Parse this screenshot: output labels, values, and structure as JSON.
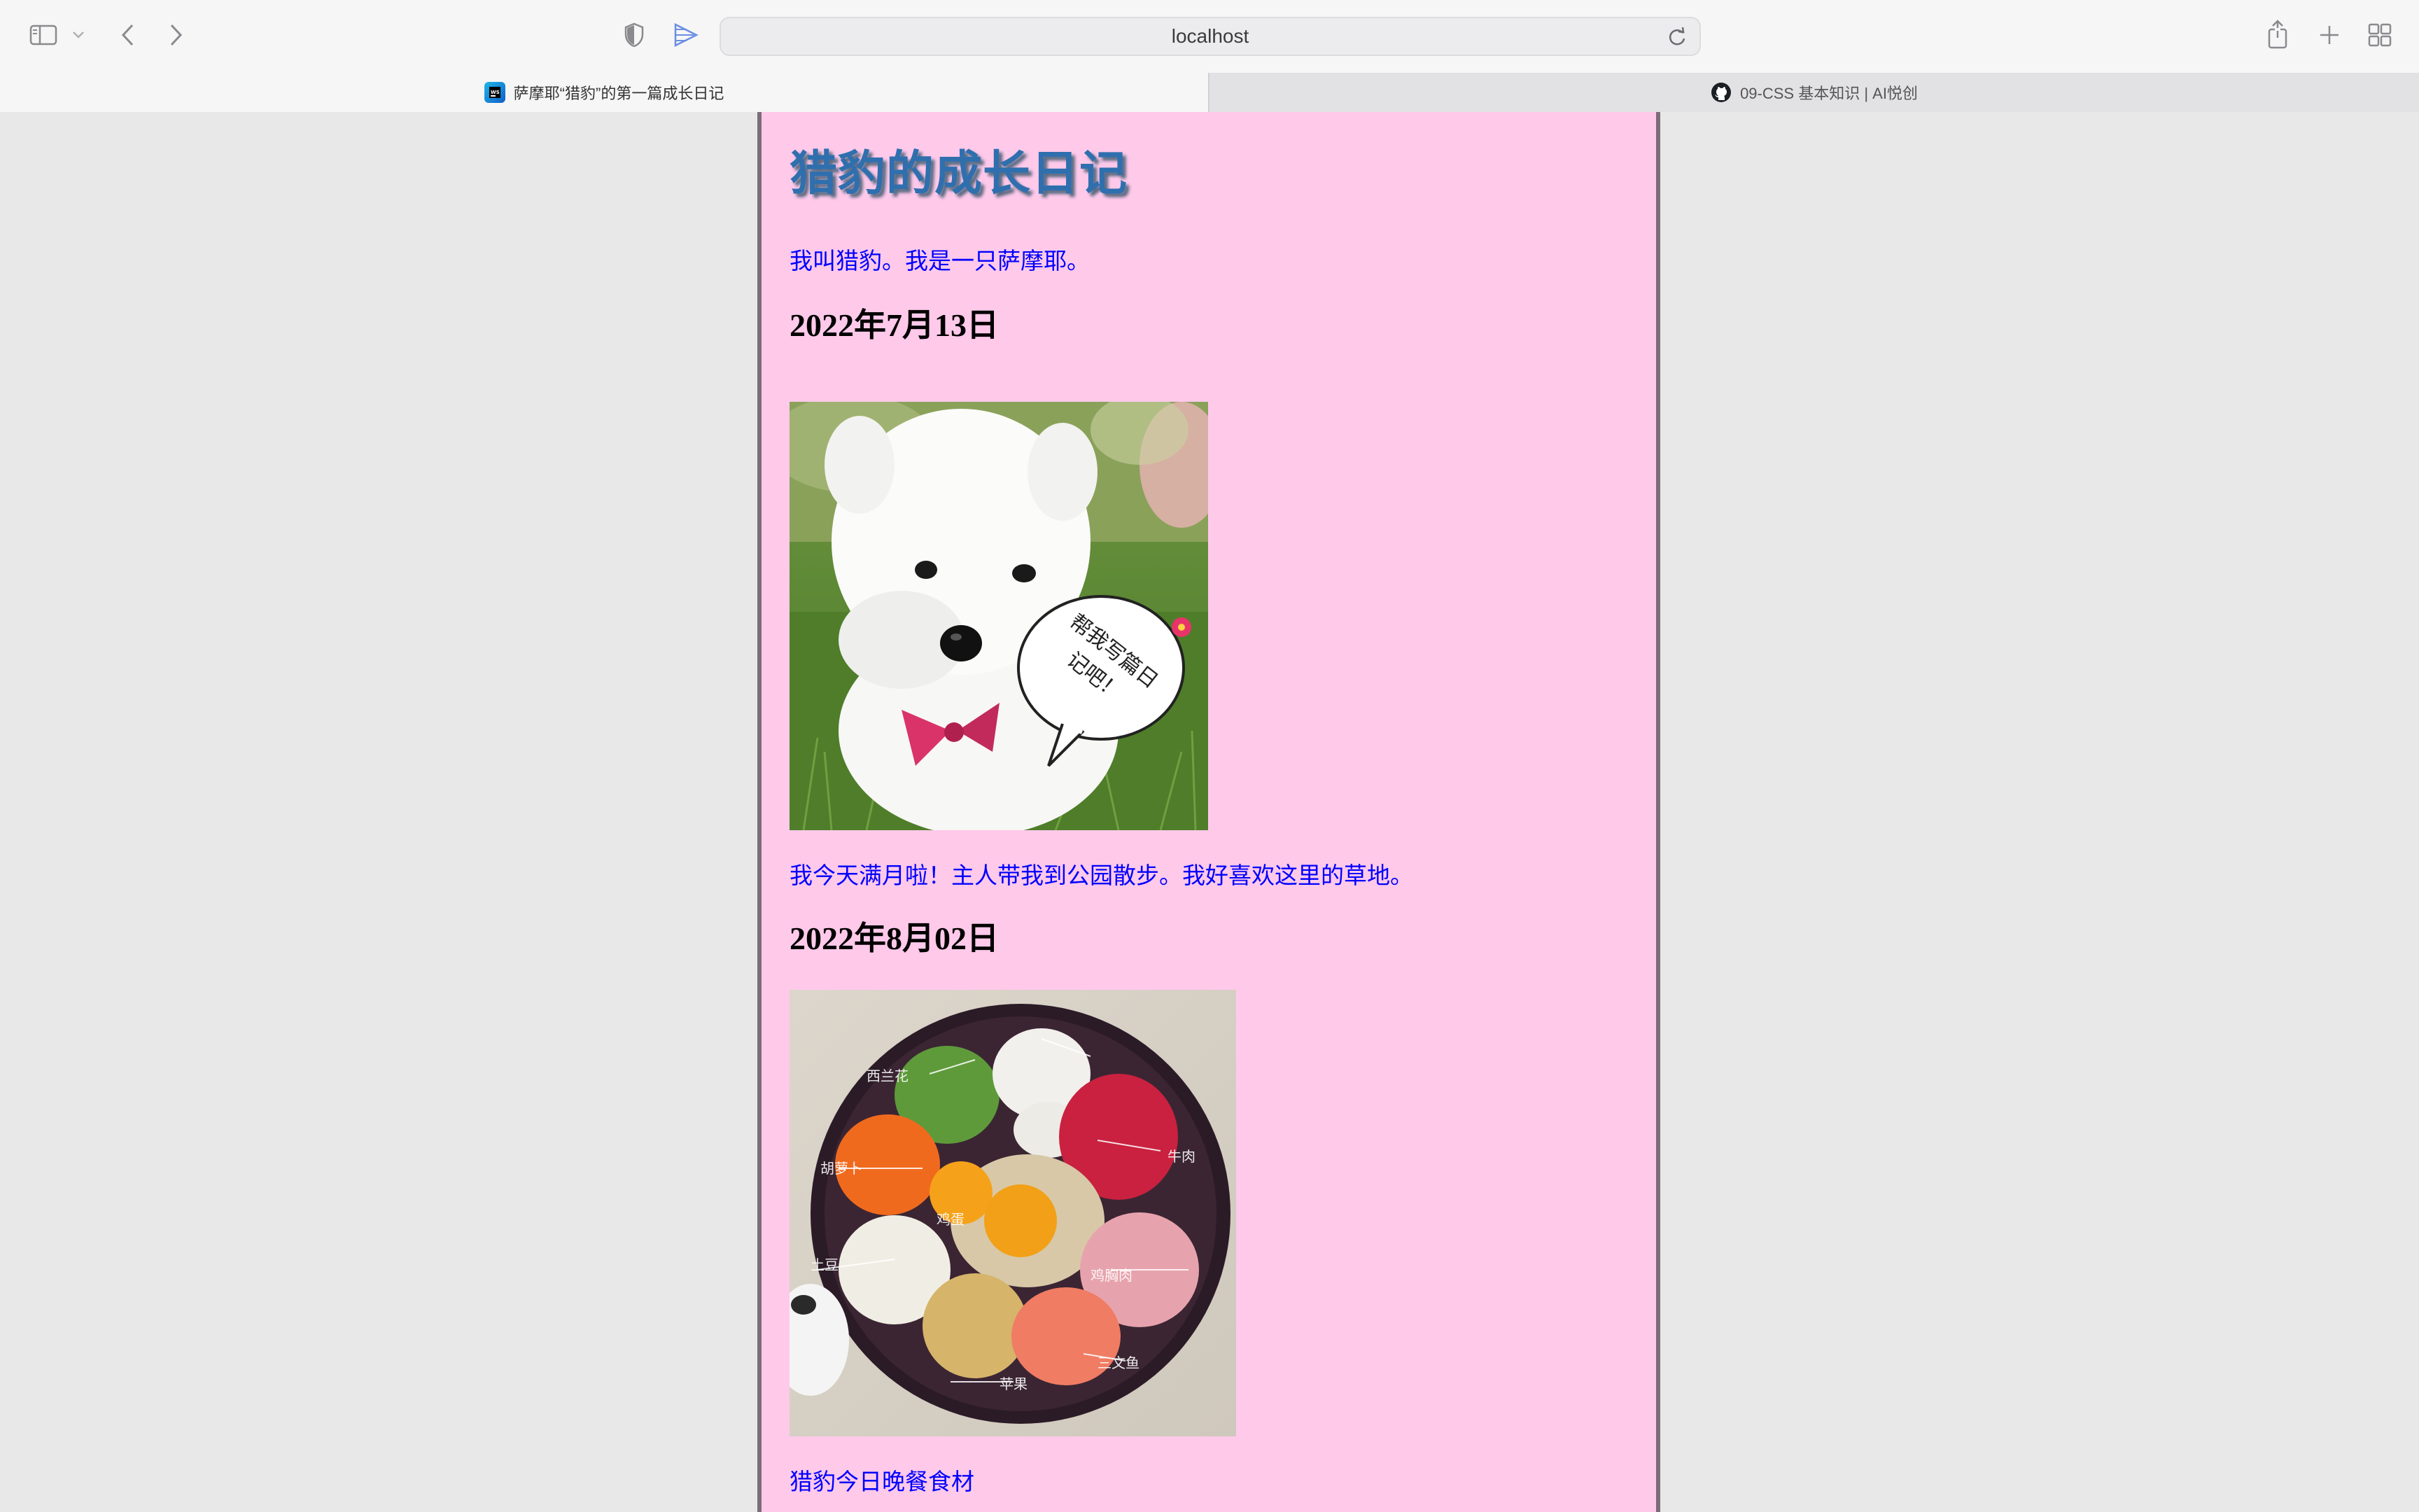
{
  "browser": {
    "url": "localhost",
    "tabs": [
      {
        "title": "萨摩耶“猎豹”的第一篇成长日记",
        "active": true
      },
      {
        "title": "09-CSS 基本知识 | AI悦创",
        "active": false
      }
    ]
  },
  "page": {
    "title": "猎豹的成长日记",
    "intro": "我叫猎豹。我是一只萨摩耶。",
    "entries": [
      {
        "date": "2022年7月13日",
        "image_alt": "白色萨摩耶幼犬坐在草地上",
        "bubble_text": [
          "帮我写篇日",
          "记吧！"
        ],
        "text": "我今天满月啦！主人带我到公园散步。我好喜欢这里的草地。"
      },
      {
        "date": "2022年8月02日",
        "image_alt": "一盘狗粮食材",
        "food_labels": [
          "西兰花",
          "鸡蛋",
          "牛肉",
          "胡萝卜",
          "土豆",
          "鸡胸肉",
          "苹果",
          "三文鱼"
        ],
        "text": "猎豹今日晚餐食材"
      }
    ]
  },
  "colors": {
    "page_bg": "#ffc9ea",
    "title": "#2f6fae",
    "paragraph": "#0000ff",
    "frame_border": "#7d6c77"
  }
}
